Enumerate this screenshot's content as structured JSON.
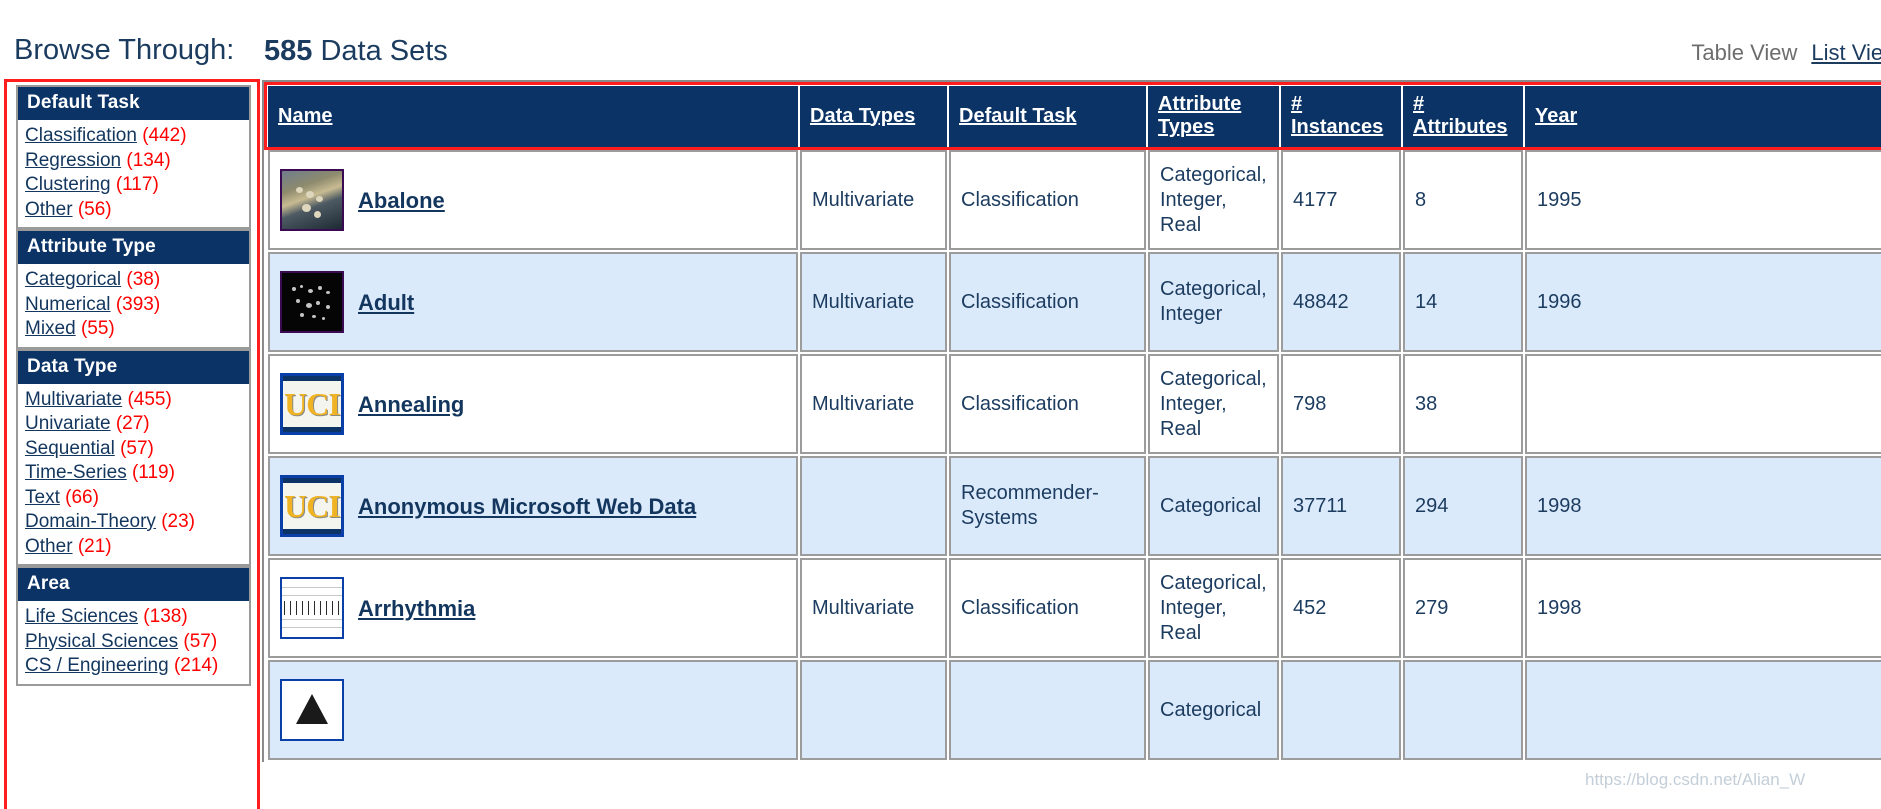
{
  "header": {
    "browse_label": "Browse Through:",
    "count": "585",
    "count_suffix": " Data Sets",
    "table_view": "Table View",
    "list_view": "List View"
  },
  "sidebar": {
    "sections": [
      {
        "title": "Default Task",
        "items": [
          {
            "label": "Classification",
            "count": "(442)"
          },
          {
            "label": "Regression",
            "count": "(134)"
          },
          {
            "label": "Clustering",
            "count": "(117)"
          },
          {
            "label": "Other",
            "count": "(56)"
          }
        ]
      },
      {
        "title": "Attribute Type",
        "items": [
          {
            "label": "Categorical",
            "count": "(38)"
          },
          {
            "label": "Numerical",
            "count": "(393)"
          },
          {
            "label": "Mixed",
            "count": "(55)"
          }
        ]
      },
      {
        "title": "Data Type",
        "items": [
          {
            "label": "Multivariate",
            "count": "(455)"
          },
          {
            "label": "Univariate",
            "count": "(27)"
          },
          {
            "label": "Sequential",
            "count": "(57)"
          },
          {
            "label": "Time-Series",
            "count": "(119)"
          },
          {
            "label": "Text",
            "count": "(66)"
          },
          {
            "label": "Domain-Theory",
            "count": "(23)"
          },
          {
            "label": "Other",
            "count": "(21)"
          }
        ]
      },
      {
        "title": "Area",
        "items": [
          {
            "label": "Life Sciences",
            "count": "(138)"
          },
          {
            "label": "Physical Sciences",
            "count": "(57)"
          },
          {
            "label": "CS / Engineering",
            "count": "(214)"
          }
        ]
      }
    ]
  },
  "table": {
    "columns": [
      {
        "key": "name",
        "label": "Name"
      },
      {
        "key": "data_types",
        "label": "Data Types"
      },
      {
        "key": "default_task",
        "label": "Default Task"
      },
      {
        "key": "attribute_types",
        "label": "Attribute\nTypes"
      },
      {
        "key": "instances",
        "label": "#\nInstances"
      },
      {
        "key": "attributes",
        "label": "#\nAttributes"
      },
      {
        "key": "year",
        "label": "Year"
      }
    ],
    "column_labels": {
      "name": "Name",
      "data_types": "Data Types",
      "default_task": "Default Task",
      "attribute_types_1": "Attribute",
      "attribute_types_2": "Types",
      "instances_1": "#",
      "instances_2": "Instances",
      "attributes_1": "#",
      "attributes_2": "Attributes",
      "year": "Year"
    },
    "rows": [
      {
        "name": "Abalone",
        "thumb": "coast-photo-icon",
        "data_types": "Multivariate",
        "default_task": "Classification",
        "attribute_types": "Categorical, Integer, Real",
        "instances": "4177",
        "attributes": "8",
        "year": "1995"
      },
      {
        "name": "Adult",
        "thumb": "night-lights-icon",
        "data_types": "Multivariate",
        "default_task": "Classification",
        "attribute_types": "Categorical, Integer",
        "instances": "48842",
        "attributes": "14",
        "year": "1996"
      },
      {
        "name": "Annealing",
        "thumb": "uci-logo-icon",
        "data_types": "Multivariate",
        "default_task": "Classification",
        "attribute_types": "Categorical, Integer, Real",
        "instances": "798",
        "attributes": "38",
        "year": ""
      },
      {
        "name": "Anonymous Microsoft Web Data",
        "thumb": "uci-logo-icon",
        "data_types": "",
        "default_task": "Recommender-Systems",
        "attribute_types": "Categorical",
        "instances": "37711",
        "attributes": "294",
        "year": "1998"
      },
      {
        "name": "Arrhythmia",
        "thumb": "ecg-chart-icon",
        "data_types": "Multivariate",
        "default_task": "Classification",
        "attribute_types": "Categorical, Integer, Real",
        "instances": "452",
        "attributes": "279",
        "year": "1998"
      },
      {
        "name": "",
        "thumb": "mountain-photo-icon",
        "data_types": "",
        "default_task": "",
        "attribute_types": "Categorical",
        "instances": "",
        "attributes": "",
        "year": ""
      }
    ]
  },
  "watermark": "https://blog.csdn.net/Alian_W"
}
